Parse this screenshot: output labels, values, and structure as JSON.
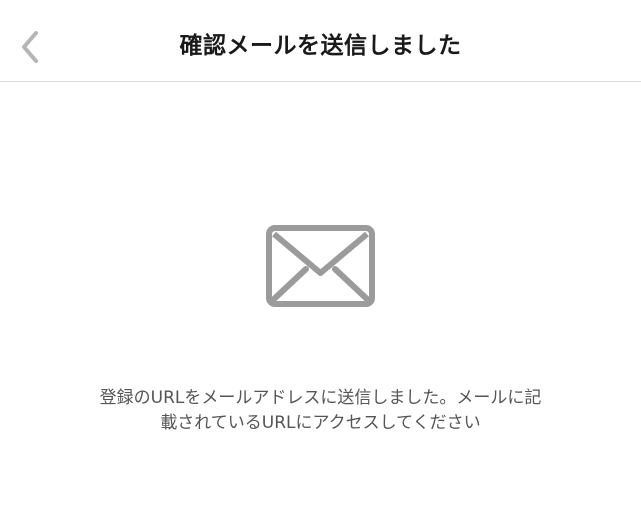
{
  "nav": {
    "title": "確認メールを送信しました"
  },
  "content": {
    "icon": "envelope-icon",
    "message_line_1": "登録のURLをメールアドレスに送信しました。メールに記",
    "message_line_2": "載されているURLにアクセスしてください"
  },
  "colors": {
    "icon": "#9b9b9b",
    "back_chevron": "#b5b5b5",
    "title": "#1a1a1a",
    "message": "#555555",
    "divider": "#dcdcdc"
  }
}
